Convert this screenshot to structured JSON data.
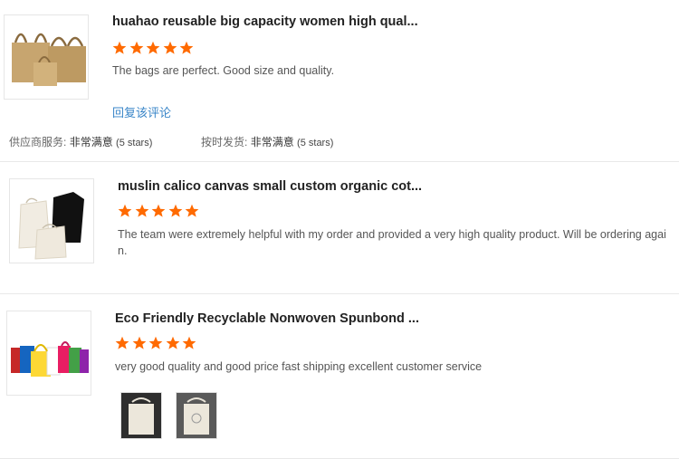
{
  "reviews": [
    {
      "title": "huahao reusable big capacity women high qual...",
      "text": "The bags are perfect. Good size and quality.",
      "reply_label": "回复该评论",
      "rating": 5,
      "ratings": [
        {
          "label": "供应商服务:",
          "value": "非常满意",
          "stars": "(5 stars)"
        },
        {
          "label": "按时发货:",
          "value": "非常满意",
          "stars": "(5 stars)"
        }
      ]
    },
    {
      "title": "muslin calico canvas small custom organic cot...",
      "text": "The team were extremely helpful with my order and provided a very high quality product. Will be ordering again.",
      "rating": 5
    },
    {
      "title": "Eco Friendly Recyclable Nonwoven Spunbond ...",
      "text": "very good quality and good price fast shipping excellent customer service",
      "rating": 5,
      "photo_count": 2
    }
  ],
  "colors": {
    "star": "#ff6a00",
    "link": "#3a86c8"
  }
}
